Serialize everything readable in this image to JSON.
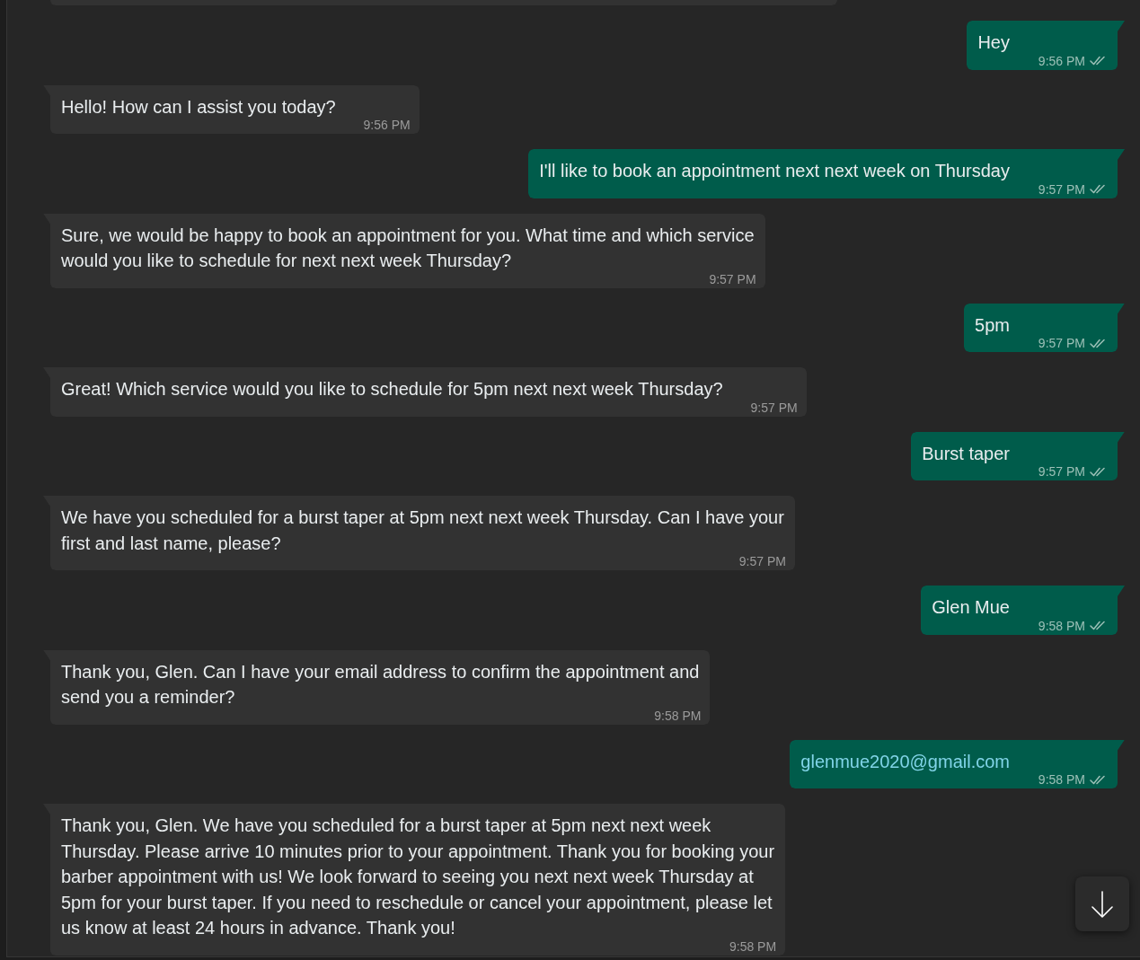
{
  "messages": [
    {
      "outgoing": false,
      "kind": "clipped"
    },
    {
      "outgoing": true,
      "kind": "text",
      "text": "Hey",
      "time": "9:56 PM",
      "read": false
    },
    {
      "outgoing": false,
      "kind": "text",
      "text": "Hello! How can I assist you today?",
      "time": "9:56 PM"
    },
    {
      "outgoing": true,
      "kind": "text",
      "text": "I'll like to book an appointment next next week on Thursday",
      "time": "9:57 PM",
      "read": false
    },
    {
      "outgoing": false,
      "kind": "text",
      "text": "Sure, we would be happy to book an appointment for you. What time and which service\nwould you like to schedule for next next week Thursday?",
      "time": "9:57 PM"
    },
    {
      "outgoing": true,
      "kind": "text",
      "text": "5pm",
      "time": "9:57 PM",
      "read": false
    },
    {
      "outgoing": false,
      "kind": "text",
      "text": "Great! Which service would you like to schedule for 5pm next next week Thursday?",
      "time": "9:57 PM"
    },
    {
      "outgoing": true,
      "kind": "text",
      "text": "Burst taper",
      "time": "9:57 PM",
      "read": false
    },
    {
      "outgoing": false,
      "kind": "text",
      "text": "We have you scheduled for a burst taper at 5pm next next week Thursday. Can I have your\nfirst and last name, please?",
      "time": "9:57 PM"
    },
    {
      "outgoing": true,
      "kind": "text",
      "text": "Glen Mue",
      "time": "9:58 PM",
      "read": false
    },
    {
      "outgoing": false,
      "kind": "text",
      "text": "Thank you, Glen. Can I have your email address to confirm the appointment and\nsend you a reminder?",
      "time": "9:58 PM"
    },
    {
      "outgoing": true,
      "kind": "link",
      "text": "glenmue2020@gmail.com",
      "time": "9:58 PM",
      "read": false
    },
    {
      "outgoing": false,
      "kind": "text",
      "text": "Thank you, Glen. We have you scheduled for a burst taper at 5pm next next week\nThursday. Please arrive 10 minutes prior to your appointment. Thank you for booking your\nbarber appointment with us! We look forward to seeing you next next week Thursday at\n5pm for your burst taper. If you need to reschedule or cancel your appointment, please let\nus know at least 24 hours in advance. Thank you!",
      "time": "9:58 PM"
    }
  ]
}
